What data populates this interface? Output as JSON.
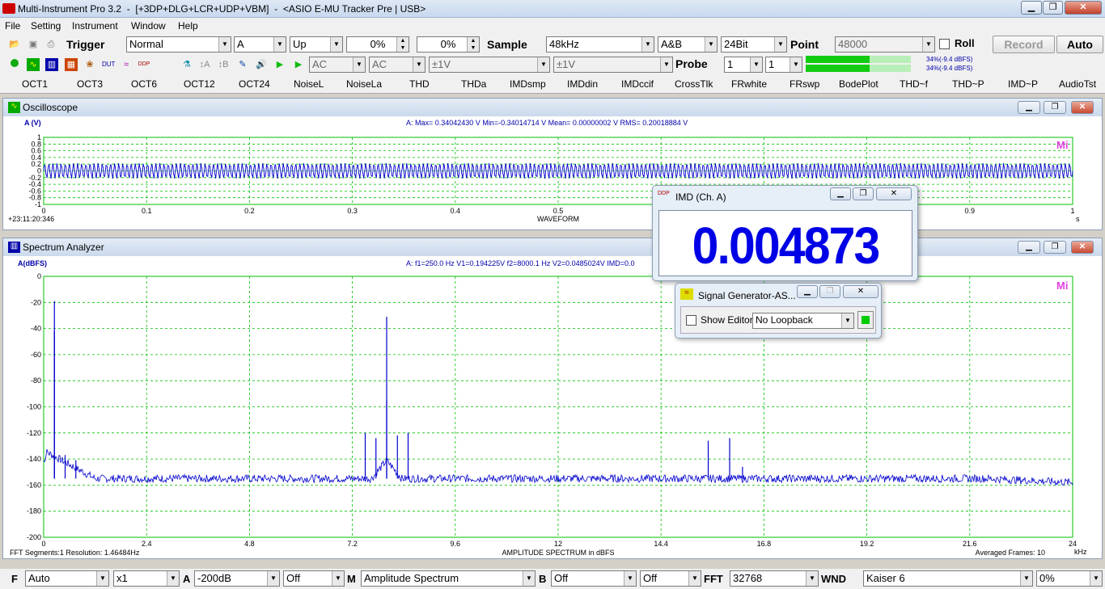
{
  "app": {
    "title": "Multi-Instrument Pro 3.2",
    "modules": "[+3DP+DLG+LCR+UDP+VBM]",
    "device": "<ASIO E-MU Tracker Pre | USB>"
  },
  "menu": [
    "File",
    "Setting",
    "Instrument",
    "Window",
    "Help"
  ],
  "toolbar1": {
    "trigger_label": "Trigger",
    "trigger_mode": "Normal",
    "channel": "A",
    "edge": "Up",
    "pct1": "0%",
    "pct2": "0%",
    "sample_label": "Sample",
    "sample_rate": "48kHz",
    "channels": "A&B",
    "bits": "24Bit",
    "point_label": "Point",
    "points": "48000",
    "roll_label": "Roll",
    "record_label": "Record",
    "auto_label": "Auto"
  },
  "toolbar2": {
    "couple_a": "AC",
    "couple_b": "AC",
    "range_a": "±1V",
    "range_b": "±1V",
    "probe_label": "Probe",
    "probe_a": "1",
    "probe_b": "1",
    "level_a": "34%(-9.4 dBFS)",
    "level_b": "34%(-9.4 dBFS)",
    "icons": [
      "record-icon",
      "oscilloscope-icon",
      "spectrum-icon",
      "multimeter-icon",
      "spectro-icon",
      "dut-icon",
      "signal-gen-icon",
      "ddp-icon",
      "probe-icon",
      "ta-icon",
      "tb-icon",
      "wrench-icon",
      "speaker-icon",
      "play-icon",
      "play-step-icon"
    ],
    "level_fill": 0.34
  },
  "presets": [
    "OCT1",
    "OCT3",
    "OCT6",
    "OCT12",
    "OCT24",
    "NoiseL",
    "NoiseLa",
    "THD",
    "THDa",
    "IMDsmp",
    "IMDdin",
    "IMDccif",
    "CrossTlk",
    "FRwhite",
    "FRswp",
    "BodePlot",
    "THD~f",
    "THD~P",
    "IMD~P",
    "AudioTst"
  ],
  "osc": {
    "title": "Oscilloscope",
    "ylabel": "A (V)",
    "stats": "A: Max= 0.34042430 V  Min=-0.34014714 V  Mean= 0.00000002 V  RMS= 0.20018884 V",
    "yticks": [
      "1",
      "0.8",
      "0.6",
      "0.4",
      "0.2",
      "0",
      "-0.2",
      "-0.4",
      "-0.6",
      "-0.8",
      "-1"
    ],
    "xticks": [
      "0",
      "0.1",
      "0.2",
      "0.3",
      "0.4",
      "0.5",
      "0.6",
      "0.7",
      "0.8",
      "0.9",
      "1"
    ],
    "xunit": "s",
    "xlabel": "WAVEFORM",
    "timestamp": "+23:11:20:346",
    "mark": "Mi"
  },
  "spec": {
    "title": "Spectrum Analyzer",
    "ylabel": "A(dBFS)",
    "stats": "A: f1=250.0 Hz V1=0.194225V  f2=8000.1 Hz V2=0.0485024V  IMD=0.0",
    "yticks": [
      "0",
      "-20",
      "-40",
      "-60",
      "-80",
      "-100",
      "-120",
      "-140",
      "-160",
      "-180",
      "-200"
    ],
    "xticks": [
      "0",
      "2.4",
      "4.8",
      "7.2",
      "9.6",
      "12",
      "14.4",
      "16.8",
      "19.2",
      "21.6",
      "24"
    ],
    "xunit": "kHz",
    "xlabel": "AMPLITUDE SPECTRUM in dBFS",
    "footer_left": "FFT  Segments:1     Resolution: 1.46484Hz",
    "footer_right": "Averaged Frames: 10",
    "mark": "Mi"
  },
  "imd": {
    "title": "IMD (Ch. A)",
    "value": "0.004873 %"
  },
  "siggen": {
    "title": "Signal Generator-AS...",
    "show_editor": "Show Editor",
    "loopback": "No Loopback"
  },
  "bottombar": {
    "f_label": "F",
    "f_mode": "Auto",
    "mult": "x1",
    "a_label": "A",
    "a_floor": "-200dB",
    "a_off": "Off",
    "m_label": "M",
    "m_mode": "Amplitude Spectrum",
    "b_label": "B",
    "b_off1": "Off",
    "b_off2": "Off",
    "fft_label": "FFT",
    "fft_size": "32768",
    "wnd_label": "WND",
    "window": "Kaiser 6",
    "overlap": "0%"
  },
  "chart_data": [
    {
      "type": "line",
      "title": "WAVEFORM",
      "xlabel": "s",
      "ylabel": "A (V)",
      "xlim": [
        0,
        1
      ],
      "ylim": [
        -1,
        1
      ],
      "series": [
        {
          "name": "A",
          "description_values": {
            "max": 0.3404243,
            "min": -0.34014714,
            "rms": 0.20018884
          }
        }
      ]
    },
    {
      "type": "line",
      "title": "AMPLITUDE SPECTRUM in dBFS",
      "xlabel": "kHz",
      "ylabel": "A(dBFS)",
      "xlim": [
        0,
        24
      ],
      "ylim": [
        -200,
        0
      ],
      "noise_floor": -155,
      "peaks": [
        {
          "x": 0.25,
          "y": -19
        },
        {
          "x": 0.25,
          "y": -42
        },
        {
          "x": 0.5,
          "y": -137
        },
        {
          "x": 0.75,
          "y": -141
        },
        {
          "x": 7.5,
          "y": -120
        },
        {
          "x": 7.75,
          "y": -124
        },
        {
          "x": 8.0,
          "y": -31
        },
        {
          "x": 8.0,
          "y": -95
        },
        {
          "x": 8.25,
          "y": -122
        },
        {
          "x": 8.5,
          "y": -120
        },
        {
          "x": 15.5,
          "y": -126
        },
        {
          "x": 16.0,
          "y": -124
        },
        {
          "x": 16.3,
          "y": -146
        }
      ]
    }
  ]
}
